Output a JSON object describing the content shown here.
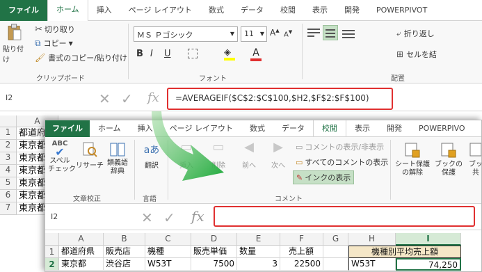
{
  "back": {
    "tabs": [
      "ファイル",
      "ホーム",
      "挿入",
      "ページ レイアウト",
      "数式",
      "データ",
      "校閲",
      "表示",
      "開発",
      "POWERPIVOT"
    ],
    "active_tab": "ホーム",
    "clipboard": {
      "paste_label": "貼り付け",
      "cut": "切り取り",
      "copy": "コピー",
      "format_painter": "書式のコピー/貼り付け",
      "group": "クリップボード"
    },
    "font": {
      "name": "ＭＳ Ｐゴシック",
      "size": "11",
      "bold": "B",
      "italic": "I",
      "underline": "U",
      "font_color_glyph": "A",
      "group": "フォント"
    },
    "alignment": {
      "wrap": "折り返し",
      "merge": "セルを結",
      "group": "配置"
    },
    "name_box": "I2",
    "formula": "=AVERAGEIF($C$2:$C$100,$H2,$F$2:$F$100)",
    "col_a": "A",
    "rows": [
      {
        "num": "1",
        "text": "都道府"
      },
      {
        "num": "2",
        "text": "東京都"
      },
      {
        "num": "3",
        "text": "東京都"
      },
      {
        "num": "4",
        "text": "東京都"
      },
      {
        "num": "5",
        "text": "東京都"
      },
      {
        "num": "6",
        "text": "東京都"
      },
      {
        "num": "7",
        "text": "東京都"
      }
    ]
  },
  "front": {
    "tabs": [
      "ファイル",
      "ホーム",
      "挿入",
      "ページ レイアウト",
      "数式",
      "データ",
      "校閲",
      "表示",
      "開発",
      "POWERPIVO"
    ],
    "active_tab": "校閲",
    "proofing": {
      "abc": "ABC",
      "spell": "スペル\nチェック",
      "research": "リサーチ",
      "thesaurus": "類義語\n辞典",
      "group": "文章校正"
    },
    "language": {
      "translate": "翻訳",
      "group": "言語"
    },
    "comments": {
      "new": "挿入",
      "delete": "削除",
      "prev": "前へ",
      "next": "次へ",
      "show_hide": "コメントの表示/非表示",
      "show_all": "すべてのコメントの表示",
      "show_ink": "インクの表示",
      "group": "コメント"
    },
    "protect": {
      "unprotect_sheet": "シート保護\nの解除",
      "protect_book": "ブックの\n保護",
      "share": "ブッ\n共"
    },
    "name_box": "I2",
    "formula": "",
    "columns": [
      "A",
      "B",
      "C",
      "D",
      "E",
      "F",
      "G",
      "H",
      "I"
    ],
    "row1": {
      "num": "1",
      "a": "都道府県",
      "b": "販売店",
      "c": "機種",
      "d": "販売単価",
      "e": "数量",
      "f": "売上額",
      "h_i": "機種別平均売上額"
    },
    "row2": {
      "num": "2",
      "a": "東京都",
      "b": "渋谷店",
      "c": "W53T",
      "d": "7500",
      "e": "3",
      "f": "22500",
      "h": "W53T",
      "i": "74,250"
    }
  },
  "colors": {
    "excel_green": "#217346",
    "arrow_green": "#1faa3c",
    "highlight_red": "#e03030"
  }
}
